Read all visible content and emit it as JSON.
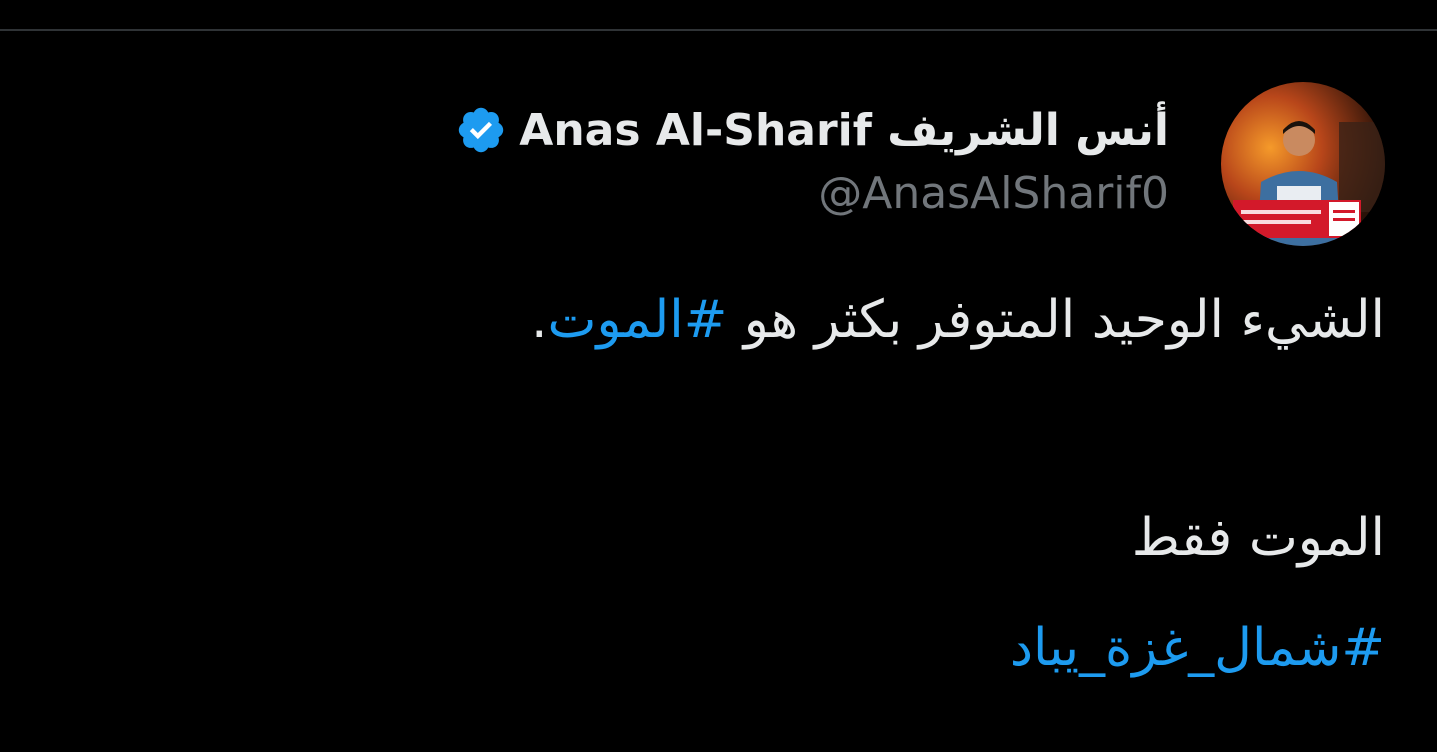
{
  "colors": {
    "background": "#000000",
    "text_primary": "#e7e9ea",
    "text_secondary": "#71767b",
    "hashtag": "#1d9bf0",
    "verified_badge": "#1d9bf0",
    "divider": "#2f3336"
  },
  "author": {
    "display_name": "أنس الشريف Anas Al-Sharif",
    "handle": "@AnasAlSharif0",
    "verified_icon": "verified-badge-icon",
    "avatar_icon": "profile-avatar"
  },
  "tweet": {
    "line1_text": "الشيء الوحيد المتوفر بكثر هو ",
    "line1_hashtag": "#الموت",
    "line1_end": ".",
    "line2_text": "الموت فقط",
    "line3_hashtag": "#شمال_غزة_يباد"
  }
}
